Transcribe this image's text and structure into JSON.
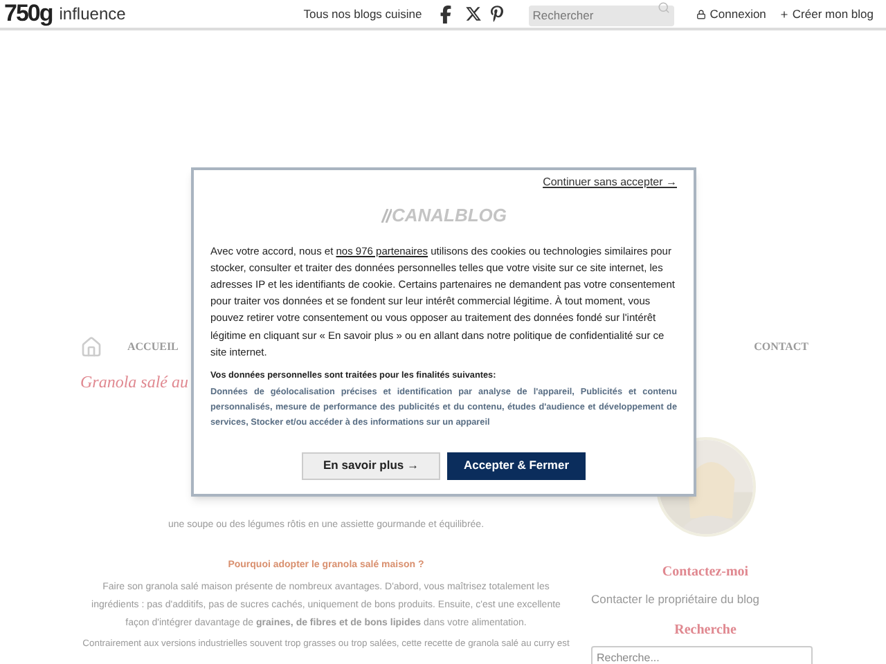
{
  "header": {
    "logo_number": "750g",
    "logo_word": "influence",
    "blogs_link": "Tous nos blogs cuisine",
    "search": {
      "placeholder": "Rechercher"
    },
    "login": "Connexion",
    "create": "Créer mon blog"
  },
  "nav": {
    "items": [
      "ACCUEIL",
      "CONTACT"
    ]
  },
  "article": {
    "title": "Granola salé au",
    "lines": [
      "une soupe ou des légumes rôtis en une assiette gourmande et équilibrée."
    ],
    "subheading": "Pourquoi adopter le granola salé maison ?",
    "paragraph": "Faire son granola salé maison présente de nombreux avantages. D'abord, vous maîtrisez totalement les ingrédients : pas d'additifs, pas de sucres cachés, uniquement de bons produits. Ensuite, c'est une excellente façon d'intégrer davantage de **graines, de fibres et de bons lipides** dans votre alimentation.",
    "paragraph2": "Contrairement aux versions industrielles souvent trop grasses ou trop salées, cette recette de granola salé au curry est"
  },
  "sidebar": {
    "contact_title": "Contactez-moi",
    "contact_link": "Contacter le propriétaire du blog",
    "search_title": "Recherche",
    "search": {
      "placeholder": "Recherche..."
    }
  },
  "consent": {
    "skip": "Continuer sans accepter →",
    "logo": "CANALBLOG",
    "intro_before": "Avec votre accord, nous et ",
    "partners_link": "nos 976 partenaires",
    "intro_after": " utilisons des cookies ou technologies similaires pour stocker, consulter et traiter des données personnelles telles que votre visite sur ce site internet, les adresses IP et les identifiants de cookie. Certains partenaires ne demandent pas votre consentement pour traiter vos données et se fondent sur leur intérêt commercial légitime. À tout moment, vous pouvez retirer votre consentement ou vous opposer au traitement des données fondé sur l'intérêt légitime en cliquant sur « En savoir plus » ou en allant dans notre politique de confidentialité sur ce site internet.",
    "purposes_title": "Vos données personnelles sont traitées pour les finalités suivantes:",
    "purposes": "Données de géolocalisation précises et identification par analyse de l'appareil, Publicités et contenu personnalisés, mesure de performance des publicités et du contenu, études d'audience et développement de services, Stocker et/ou accéder à des informations sur un appareil",
    "buttons": [
      {
        "label": "En savoir plus →",
        "kind": "secondary"
      },
      {
        "label": "Accepter & Fermer",
        "kind": "primary"
      }
    ]
  }
}
